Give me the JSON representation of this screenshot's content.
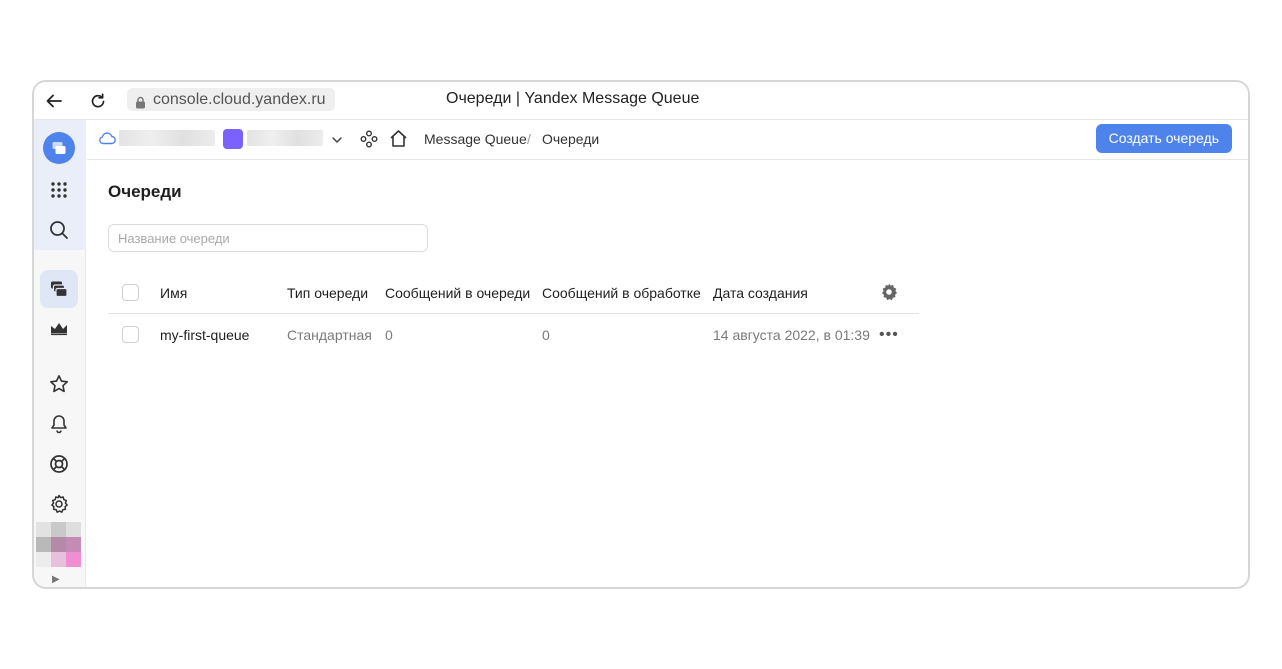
{
  "browser": {
    "url": "console.cloud.yandex.ru",
    "title": "Очереди | Yandex Message Queue"
  },
  "topnav": {
    "breadcrumb": [
      "Message Queue",
      "Очереди"
    ],
    "separator": "/",
    "create_button": "Создать очередь"
  },
  "main": {
    "title": "Очереди",
    "search": {
      "placeholder": "Название очереди",
      "value": ""
    }
  },
  "table": {
    "columns": [
      "Имя",
      "Тип очереди",
      "Сообщений в очереди",
      "Сообщений в обработке",
      "Дата создания"
    ],
    "rows": [
      {
        "name": "my-first-queue",
        "type": "Стандартная",
        "messages_in_queue": "0",
        "messages_in_processing": "0",
        "created": "14 августа 2022, в 01:39",
        "actions": "•••"
      }
    ]
  },
  "sidebar": {
    "items": [
      "cloud-logo-icon",
      "apps-grid-icon",
      "search-icon",
      "message-queue-icon",
      "monitoring-icon",
      "star-icon",
      "bell-icon",
      "lifebuoy-icon",
      "gear-icon"
    ],
    "expand": "▶"
  },
  "colors": {
    "accent": "#4f83ec",
    "folder": "#7b61ff"
  }
}
